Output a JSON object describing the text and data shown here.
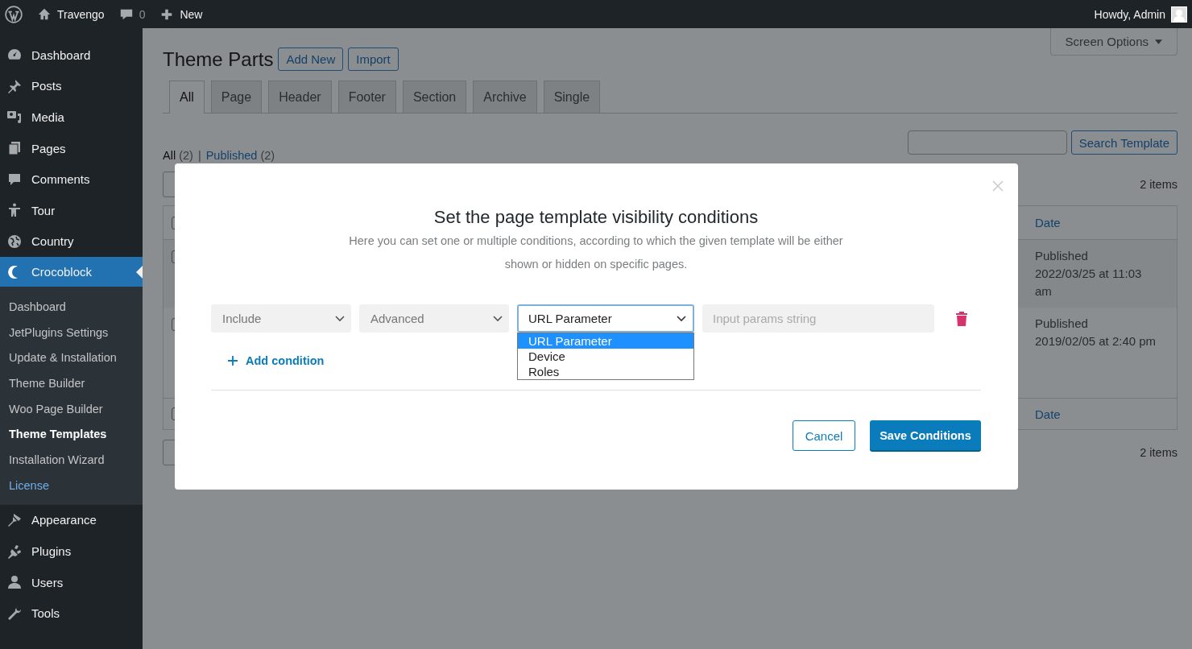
{
  "admin_bar": {
    "site": "Travengo",
    "comments": "0",
    "new": "New",
    "greeting": "Howdy, Admin"
  },
  "sidebar": {
    "items": [
      {
        "label": "Dashboard",
        "selected": false
      },
      {
        "label": "Posts",
        "selected": false
      },
      {
        "label": "Media",
        "selected": false
      },
      {
        "label": "Pages",
        "selected": false
      },
      {
        "label": "Comments",
        "selected": false
      },
      {
        "label": "Tour",
        "selected": false
      },
      {
        "label": "Country",
        "selected": false
      },
      {
        "label": "Crocoblock",
        "selected": true,
        "children": [
          {
            "label": "Dashboard",
            "selected": false,
            "kind": "item"
          },
          {
            "label": "JetPlugins Settings",
            "selected": false,
            "kind": "item"
          },
          {
            "label": "Update & Installation",
            "selected": false,
            "kind": "item"
          },
          {
            "label": "Theme Builder",
            "selected": false,
            "kind": "item"
          },
          {
            "label": "Woo Page Builder",
            "selected": false,
            "kind": "item"
          },
          {
            "label": "Theme Templates",
            "selected": true,
            "kind": "item"
          },
          {
            "label": "Installation Wizard",
            "selected": false,
            "kind": "item"
          },
          {
            "label": "License",
            "selected": false,
            "kind": "accent"
          }
        ]
      },
      {
        "label": "Appearance",
        "selected": false
      },
      {
        "label": "Plugins",
        "selected": false
      },
      {
        "label": "Users",
        "selected": false
      },
      {
        "label": "Tools",
        "selected": false
      }
    ]
  },
  "page": {
    "screen_options": "Screen Options",
    "title": "Theme Parts",
    "actions": [
      "Add New",
      "Import"
    ],
    "tabs": [
      {
        "label": "All",
        "selected": true
      },
      {
        "label": "Page",
        "selected": false
      },
      {
        "label": "Header",
        "selected": false
      },
      {
        "label": "Footer",
        "selected": false
      },
      {
        "label": "Section",
        "selected": false
      },
      {
        "label": "Archive",
        "selected": false
      },
      {
        "label": "Single",
        "selected": false
      }
    ],
    "views_separator": "|",
    "views": [
      {
        "label": "All",
        "count": "(2)",
        "selected": true
      },
      {
        "label": "Published",
        "count": "(2)",
        "selected": false
      }
    ],
    "search_button": "Search Template",
    "items_count_top": "2 items",
    "items_count_bottom": "2 items",
    "table": {
      "date_column": "Date",
      "footer_date_column": "Date",
      "rows": [
        {
          "date_lines": [
            "Published",
            "2022/03/25 at 11:03",
            "am"
          ]
        },
        {
          "date_lines": [
            "Published",
            "2019/02/05 at 2:40 pm"
          ]
        }
      ]
    }
  },
  "modal": {
    "title": "Set the page template visibility conditions",
    "description": "Here you can set one or multiple conditions, according to which the given template will be either shown or hidden on specific pages.",
    "condition": {
      "include": "Include",
      "type": "Advanced",
      "subtype": {
        "value": "URL Parameter",
        "expanded": true,
        "options": [
          {
            "label": "URL Parameter",
            "selected": true
          },
          {
            "label": "Device",
            "selected": false
          },
          {
            "label": "Roles",
            "selected": false
          }
        ]
      },
      "param_placeholder": "Input params string"
    },
    "add_condition": "Add condition",
    "cancel": "Cancel",
    "save": "Save Conditions"
  }
}
